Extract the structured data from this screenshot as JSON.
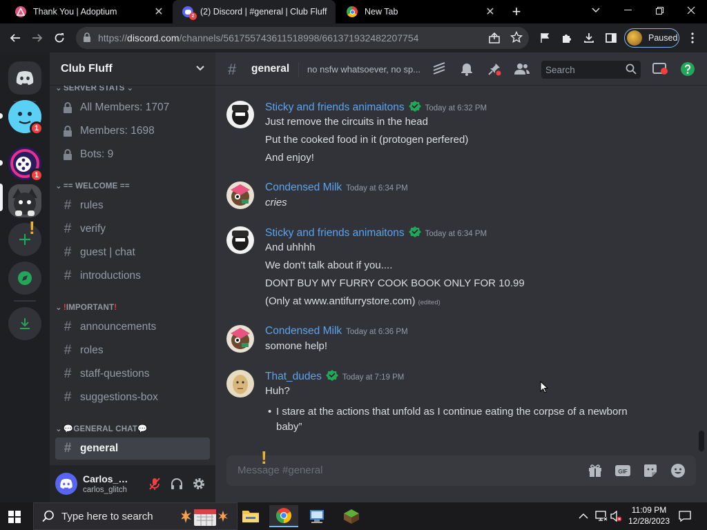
{
  "browser": {
    "tabs": [
      {
        "title": "Thank You | Adoptium",
        "active": false
      },
      {
        "title": "(2) Discord | #general | Club Fluff",
        "active": true
      },
      {
        "title": "New Tab",
        "active": false
      }
    ],
    "url_prefix": "https://",
    "url_domain": "discord.com",
    "url_path": "/channels/561755743611518998/661371932482207754",
    "profile_label": "Paused",
    "new_tab_symbol": "+"
  },
  "guild_badges": {
    "guild1": "1",
    "guild2": "1"
  },
  "server": {
    "name": "Club Fluff",
    "categories": {
      "server_stats": "SERVER STATS",
      "welcome": "== WELCOME ==",
      "important": "IMPORTANT",
      "general_chat": "GENERAL CHAT"
    },
    "stats": [
      "All Members: 1707",
      "Members: 1698",
      "Bots: 9"
    ],
    "welcome_channels": [
      "rules",
      "verify",
      "guest | chat",
      "introductions"
    ],
    "important_channels": [
      "announcements",
      "roles",
      "staff-questions",
      "suggestions-box"
    ],
    "general_channels": [
      "general"
    ]
  },
  "user": {
    "name": "Carlos_Gli...",
    "tag": "carlos_glitch"
  },
  "channel": {
    "name": "general",
    "topic": "no nsfw whatsoever, no sp...",
    "search_placeholder": "Search"
  },
  "messages": [
    {
      "author": "Sticky and friends animaitons",
      "time": "Today at 6:32 PM",
      "lines": [
        "Just remove the circuits in the head",
        "Put the cooked food in it (protogen perfered)",
        "And enjoy!"
      ]
    },
    {
      "author": "Condensed Milk",
      "time": "Today at 6:34 PM",
      "lines": [
        "cries"
      ]
    },
    {
      "author": "Sticky and friends animaitons",
      "time": "Today at 6:34 PM",
      "lines": [
        "And uhhhh",
        "We don't talk about if you....",
        "DONT BUY MY FURRY COOK BOOK ONLY FOR 10.99",
        "(Only at www.antifurrystore.com)"
      ],
      "edited": "(edited)"
    },
    {
      "author": "Condensed Milk",
      "time": "Today at 6:36 PM",
      "lines": [
        "somone help!"
      ]
    },
    {
      "author": "That_dudes",
      "time": "Today at 7:19 PM",
      "lines": [
        "Huh?"
      ],
      "bullet": [
        "I stare at the actions that unfold as I continue eating the corpse of a newborn",
        "baby”"
      ]
    }
  ],
  "composer": {
    "placeholder": "Message #general"
  },
  "taskbar": {
    "search_placeholder": "Type here to search",
    "time": "11:09 PM",
    "date": "12/28/2023"
  },
  "colors": {
    "accent": "#5865f2",
    "author_link": "#5aa4f0",
    "badge_red": "#f23f42",
    "bot_green": "#23a55a"
  }
}
